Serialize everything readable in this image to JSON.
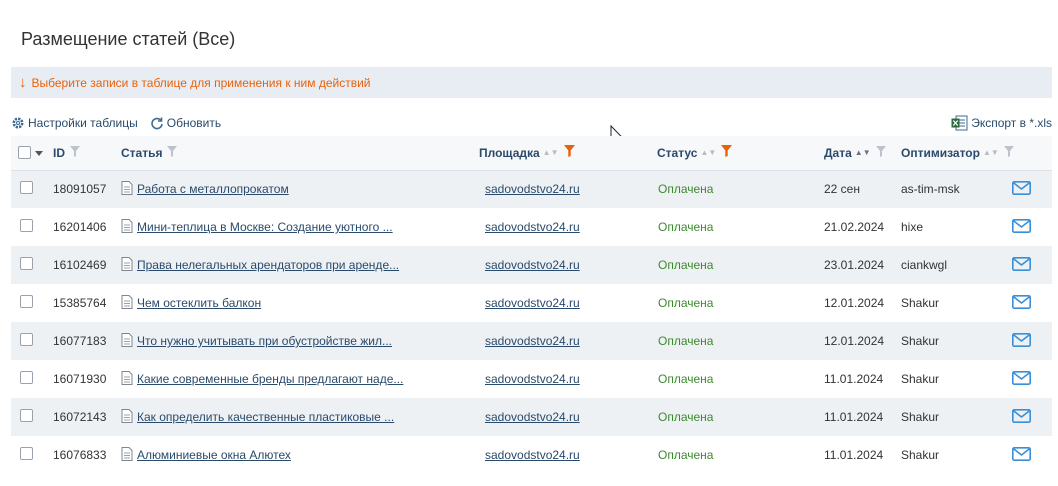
{
  "page": {
    "title": "Размещение статей (Все)"
  },
  "notice": {
    "text": "Выберите записи в таблице для применения к ним действий"
  },
  "toolbar": {
    "settings_label": "Настройки таблицы",
    "refresh_label": "Обновить",
    "export_label": "Экспорт в *.xls"
  },
  "columns": {
    "id": "ID",
    "article": "Статья",
    "site": "Площадка",
    "status": "Статус",
    "date": "Дата",
    "optimizer": "Оптимизатор"
  },
  "rows": [
    {
      "id": "18091057",
      "article": "Работа с металлопрокатом",
      "site": "sadovodstvo24.ru",
      "status": "Оплачена",
      "date": "22 сен",
      "optimizer": "as-tim-msk"
    },
    {
      "id": "16201406",
      "article": "Мини-теплица в Москве: Создание уютного ...",
      "site": "sadovodstvo24.ru",
      "status": "Оплачена",
      "date": "21.02.2024",
      "optimizer": "hixe"
    },
    {
      "id": "16102469",
      "article": "Права нелегальных арендаторов при аренде...",
      "site": "sadovodstvo24.ru",
      "status": "Оплачена",
      "date": "23.01.2024",
      "optimizer": "ciankwgl"
    },
    {
      "id": "15385764",
      "article": "Чем остеклить балкон",
      "site": "sadovodstvo24.ru",
      "status": "Оплачена",
      "date": "12.01.2024",
      "optimizer": "Shakur"
    },
    {
      "id": "16077183",
      "article": "Что нужно учитывать при обустройстве жил...",
      "site": "sadovodstvo24.ru",
      "status": "Оплачена",
      "date": "12.01.2024",
      "optimizer": "Shakur"
    },
    {
      "id": "16071930",
      "article": "Какие современные бренды предлагают наде...",
      "site": "sadovodstvo24.ru",
      "status": "Оплачена",
      "date": "11.01.2024",
      "optimizer": "Shakur"
    },
    {
      "id": "16072143",
      "article": "Как определить качественные пластиковые ...",
      "site": "sadovodstvo24.ru",
      "status": "Оплачена",
      "date": "11.01.2024",
      "optimizer": "Shakur"
    },
    {
      "id": "16076833",
      "article": "Алюминиевые окна Алютех",
      "site": "sadovodstvo24.ru",
      "status": "Оплачена",
      "date": "11.01.2024",
      "optimizer": "Shakur"
    }
  ],
  "colors": {
    "link": "#2a4a6b",
    "status_paid": "#3c8a2e",
    "notice": "#e8620c",
    "filter_active": "#e8620c",
    "mail": "#3a8fd6"
  },
  "icons": {
    "settings": "gear-icon",
    "refresh": "refresh-icon",
    "export": "xls-icon",
    "row_action": "mail-icon",
    "article": "document-icon"
  }
}
